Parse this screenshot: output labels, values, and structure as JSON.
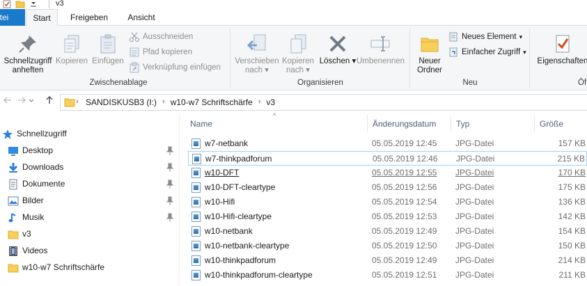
{
  "window": {
    "title": "v3"
  },
  "ribbon_tabs": [
    {
      "label": "atei"
    },
    {
      "label": "Start"
    },
    {
      "label": "Freigeben"
    },
    {
      "label": "Ansicht"
    }
  ],
  "ribbon": {
    "clipboard": {
      "pin_label_1": "Schnellzugriff",
      "pin_label_2": "anheften",
      "copy_label": "Kopieren",
      "paste_label": "Einfügen",
      "cut_label": "Ausschneiden",
      "copy_path_label": "Pfad kopieren",
      "paste_shortcut_label": "Verknüpfung einfügen",
      "group_label": "Zwischenablage"
    },
    "organize": {
      "move_label_1": "Verschieben",
      "move_label_2": "nach",
      "copyto_label_1": "Kopieren",
      "copyto_label_2": "nach",
      "delete_label": "Löschen",
      "rename_label": "Umbenennen",
      "group_label": "Organisieren"
    },
    "new": {
      "new_folder_label_1": "Neuer",
      "new_folder_label_2": "Ordner",
      "new_item_label": "Neues Element",
      "easy_access_label": "Einfacher Zugriff",
      "group_label": "Neu"
    },
    "open": {
      "properties_label": "Eigenschaften",
      "group_label": "Öf"
    }
  },
  "address": {
    "crumbs": [
      "SANDISKUSB3 (I:)",
      "w10-w7 Schriftschärfe",
      "v3"
    ]
  },
  "nav_pane": {
    "quick_access": "Schnellzugriff",
    "items": [
      {
        "label": "Desktop",
        "icon": "desktop-icon",
        "pinned": true
      },
      {
        "label": "Downloads",
        "icon": "downloads-icon",
        "pinned": true
      },
      {
        "label": "Dokumente",
        "icon": "documents-icon",
        "pinned": true
      },
      {
        "label": "Bilder",
        "icon": "pictures-icon",
        "pinned": true
      },
      {
        "label": "Musik",
        "icon": "music-icon",
        "pinned": true
      },
      {
        "label": "v3",
        "icon": "folder-icon",
        "pinned": false
      },
      {
        "label": "Videos",
        "icon": "videos-icon",
        "pinned": false
      },
      {
        "label": "w10-w7 Schriftschärfe",
        "icon": "folder-icon",
        "pinned": false
      }
    ]
  },
  "columns": {
    "name": "Name",
    "date": "Änderungsdatum",
    "type": "Typ",
    "size": "Größe"
  },
  "files": [
    {
      "name": "w7-netbank",
      "date": "05.05.2019 12:45",
      "type": "JPG-Datei",
      "size": "157 KB"
    },
    {
      "name": "w7-thinkpadforum",
      "date": "05.05.2019 12:46",
      "type": "JPG-Datei",
      "size": "215 KB"
    },
    {
      "name": "w10-DFT",
      "date": "05.05.2019 12:55",
      "type": "JPG-Datei",
      "size": "170 KB"
    },
    {
      "name": "w10-DFT-cleartype",
      "date": "05.05.2019 12:56",
      "type": "JPG-Datei",
      "size": "175 KB"
    },
    {
      "name": "w10-Hifi",
      "date": "05.05.2019 12:54",
      "type": "JPG-Datei",
      "size": "136 KB"
    },
    {
      "name": "w10-Hifi-cleartype",
      "date": "05.05.2019 12:53",
      "type": "JPG-Datei",
      "size": "142 KB"
    },
    {
      "name": "w10-netbank",
      "date": "05.05.2019 12:49",
      "type": "JPG-Datei",
      "size": "154 KB"
    },
    {
      "name": "w10-netbank-cleartype",
      "date": "05.05.2019 12:50",
      "type": "JPG-Datei",
      "size": "150 KB"
    },
    {
      "name": "w10-thinkpadforum",
      "date": "05.05.2019 12:49",
      "type": "JPG-Datei",
      "size": "214 KB"
    },
    {
      "name": "w10-thinkpadforum-cleartype",
      "date": "05.05.2019 12:51",
      "type": "JPG-Datei",
      "size": "211 KB"
    }
  ]
}
